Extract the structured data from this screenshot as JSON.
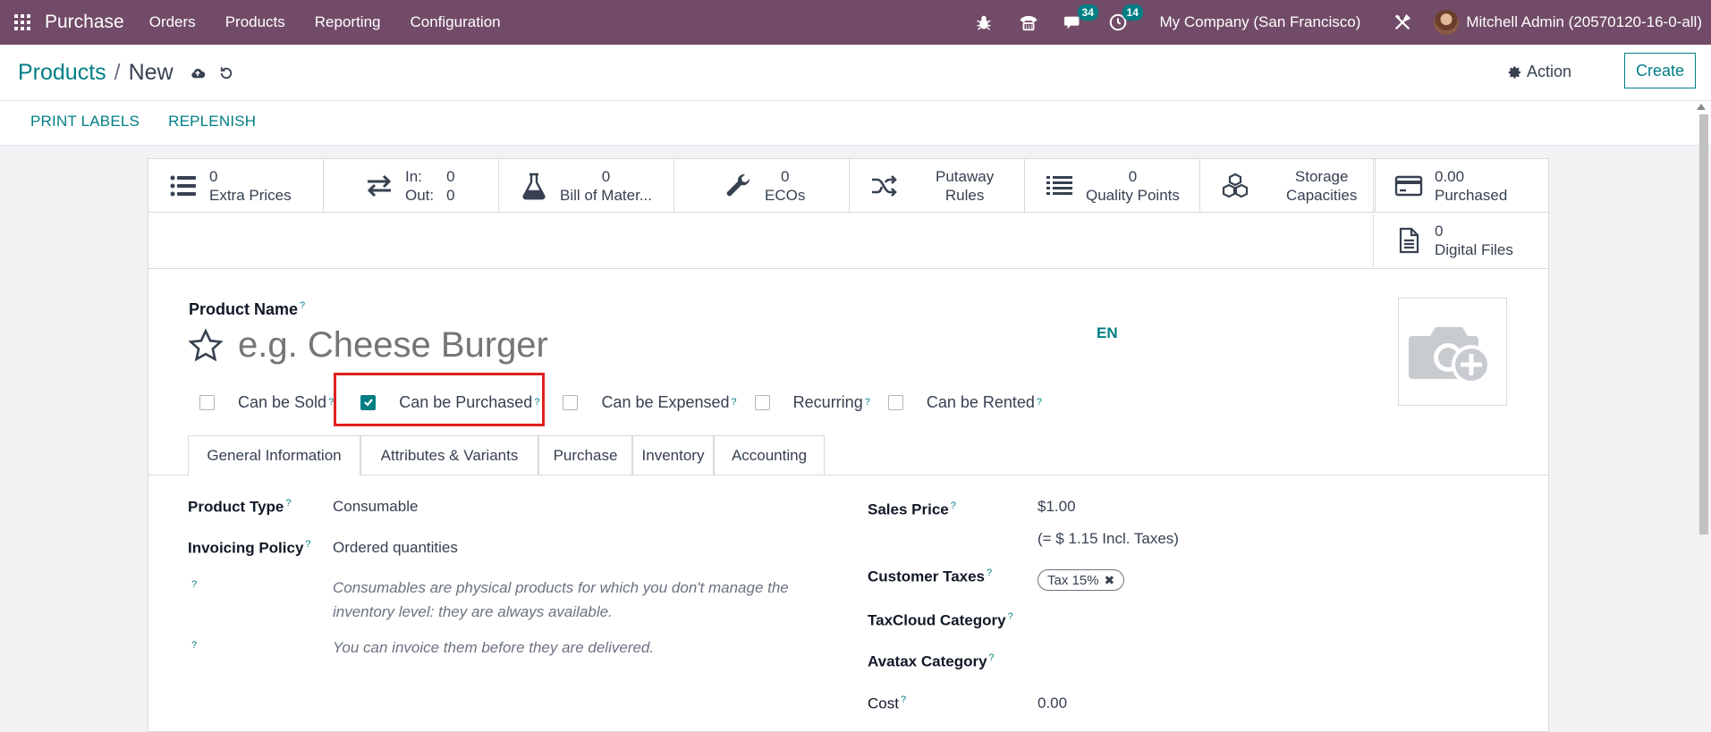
{
  "navbar": {
    "app_name": "Purchase",
    "menus": [
      "Orders",
      "Products",
      "Reporting",
      "Configuration"
    ],
    "messages_badge": "34",
    "activities_badge": "14",
    "company": "My Company (San Francisco)",
    "user": "Mitchell Admin (20570120-16-0-all)"
  },
  "breadcrumb": {
    "parent": "Products",
    "separator": "/",
    "current": "New"
  },
  "control": {
    "action_label": "Action",
    "create_label": "Create"
  },
  "header_buttons": {
    "print_labels": "PRINT LABELS",
    "replenish": "REPLENISH"
  },
  "smart_buttons": {
    "extra_prices": {
      "value": "0",
      "label": "Extra Prices"
    },
    "in_out": {
      "in_label": "In:",
      "in_value": "0",
      "out_label": "Out:",
      "out_value": "0"
    },
    "bom": {
      "value": "0",
      "label": "Bill of Mater..."
    },
    "ecos": {
      "value": "0",
      "label": "ECOs"
    },
    "putaway": {
      "line1": "Putaway",
      "line2": "Rules"
    },
    "quality": {
      "value": "0",
      "label": "Quality Points"
    },
    "storage": {
      "line1": "Storage",
      "line2": "Capacities"
    },
    "purchased": {
      "value": "0.00",
      "label": "Purchased"
    },
    "digital": {
      "value": "0",
      "label": "Digital Files"
    }
  },
  "form": {
    "product_name_label": "Product Name",
    "product_name_placeholder": "e.g. Cheese Burger",
    "lang": "EN",
    "help_mark": "?",
    "checkboxes": {
      "can_be_sold": {
        "label": "Can be Sold",
        "checked": false
      },
      "can_be_purchased": {
        "label": "Can be Purchased",
        "checked": true
      },
      "can_be_expensed": {
        "label": "Can be Expensed",
        "checked": false
      },
      "recurring": {
        "label": "Recurring",
        "checked": false
      },
      "can_be_rented": {
        "label": "Can be Rented",
        "checked": false
      }
    },
    "tabs": [
      "General Information",
      "Attributes & Variants",
      "Purchase",
      "Inventory",
      "Accounting"
    ],
    "active_tab": "General Information",
    "product_type_label": "Product Type",
    "product_type_value": "Consumable",
    "invoicing_policy_label": "Invoicing Policy",
    "invoicing_policy_value": "Ordered quantities",
    "help_consumable_1": "Consumables are physical products for which you don't manage the",
    "help_consumable_2": "inventory level: they are always available.",
    "help_invoice": "You can invoice them before they are delivered.",
    "sales_price_label": "Sales Price",
    "sales_price_value": "$1.00",
    "sales_price_incl": "(= $ 1.15 Incl. Taxes)",
    "customer_taxes_label": "Customer Taxes",
    "customer_tax_tag": "Tax 15%",
    "taxcloud_label": "TaxCloud Category",
    "avatax_label": "Avatax Category",
    "cost_label": "Cost",
    "cost_value": "0.00"
  },
  "colors": {
    "navbar": "#714b67",
    "accent": "#017e84",
    "highlight": "#e02020"
  }
}
